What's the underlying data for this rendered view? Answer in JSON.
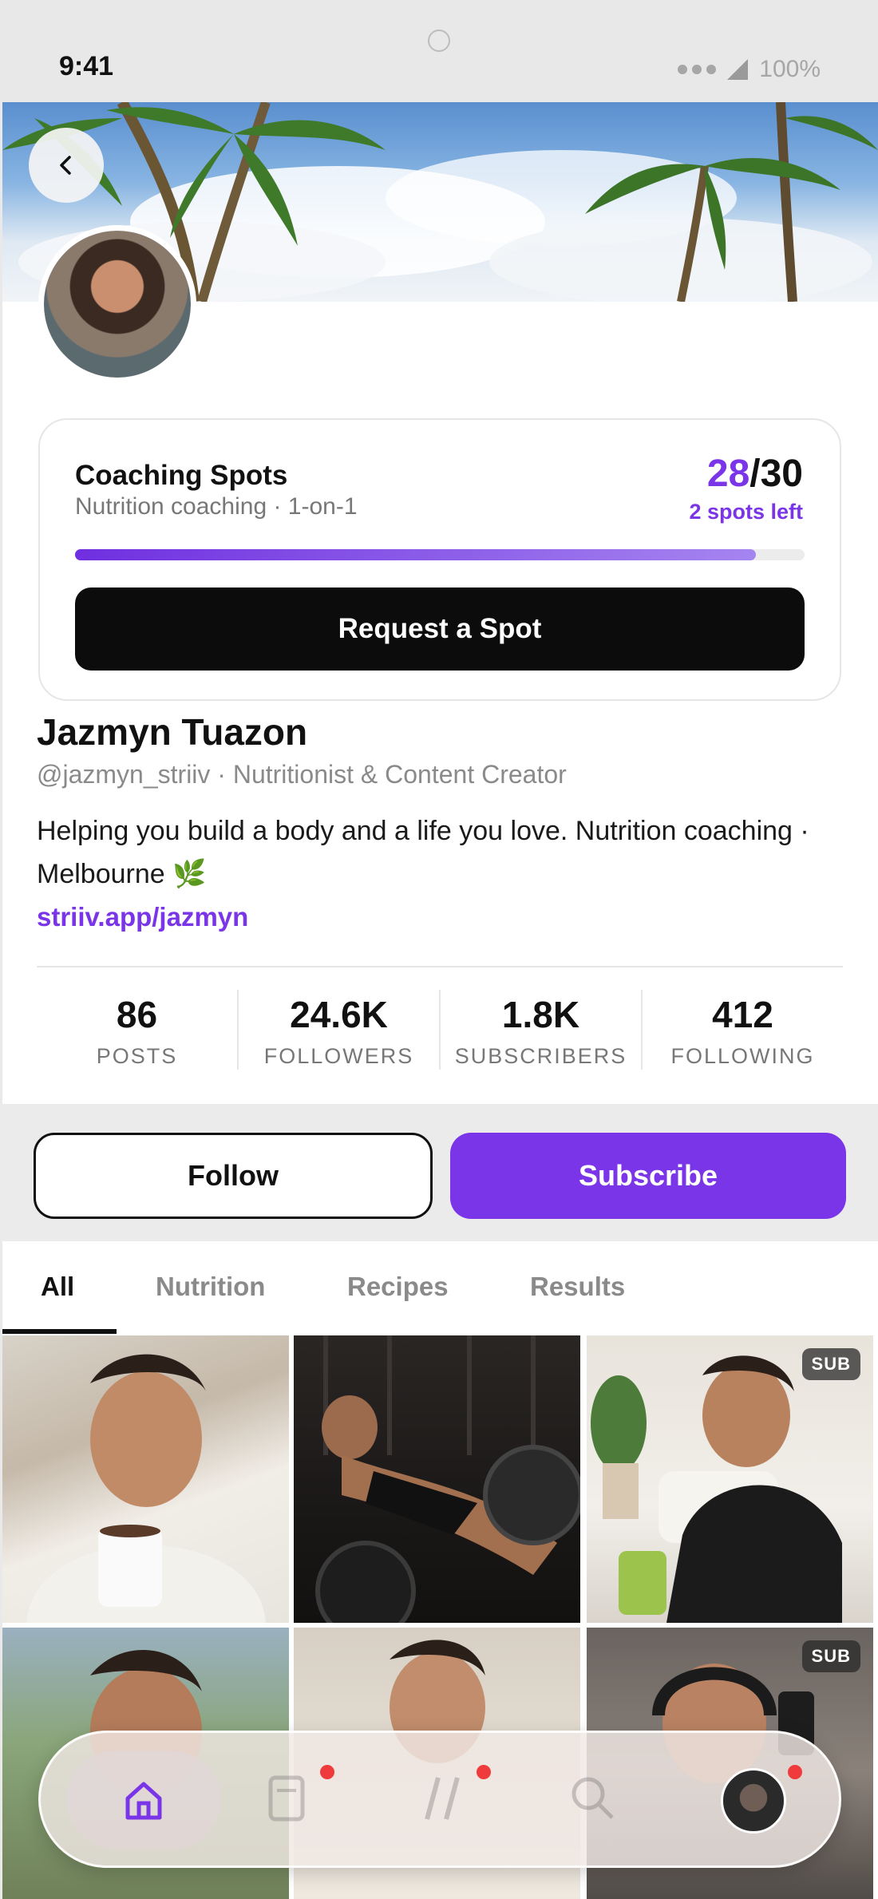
{
  "status_bar": {
    "time": "9:41",
    "battery": "100%"
  },
  "cover": {
    "description_icon": "palm-trees"
  },
  "coaching": {
    "title": "Coaching Spots",
    "subtitle": "Nutrition coaching · 1-on-1",
    "taken": "28",
    "separator_total": "/30",
    "spots_left": "2 spots left",
    "progress_fraction": 0.933,
    "cta": "Request a Spot"
  },
  "profile": {
    "name": "Jazmyn Tuazon",
    "handle": "@jazmyn_striiv · Nutritionist & Content Creator",
    "bio": "Helping you build a body and a life you love. Nutrition coaching · Melbourne 🌿",
    "link": "striiv.app/jazmyn"
  },
  "stats": [
    {
      "value": "86",
      "label": "POSTS"
    },
    {
      "value": "24.6K",
      "label": "FOLLOWERS"
    },
    {
      "value": "1.8K",
      "label": "SUBSCRIBERS"
    },
    {
      "value": "412",
      "label": "FOLLOWING"
    }
  ],
  "actions": {
    "follow": "Follow",
    "subscribe": "Subscribe"
  },
  "tabs": [
    {
      "label": "All",
      "active": true
    },
    {
      "label": "Nutrition",
      "active": false
    },
    {
      "label": "Recipes",
      "active": false
    },
    {
      "label": "Results",
      "active": false
    }
  ],
  "grid": {
    "badge": "SUB"
  },
  "colors": {
    "accent": "#7a35e8",
    "dark": "#0c0c0c",
    "notification": "#ef3b3b"
  },
  "nav": {
    "icons": [
      "home-icon",
      "document-icon",
      "slash-icon",
      "search-icon",
      "profile-avatar"
    ]
  }
}
